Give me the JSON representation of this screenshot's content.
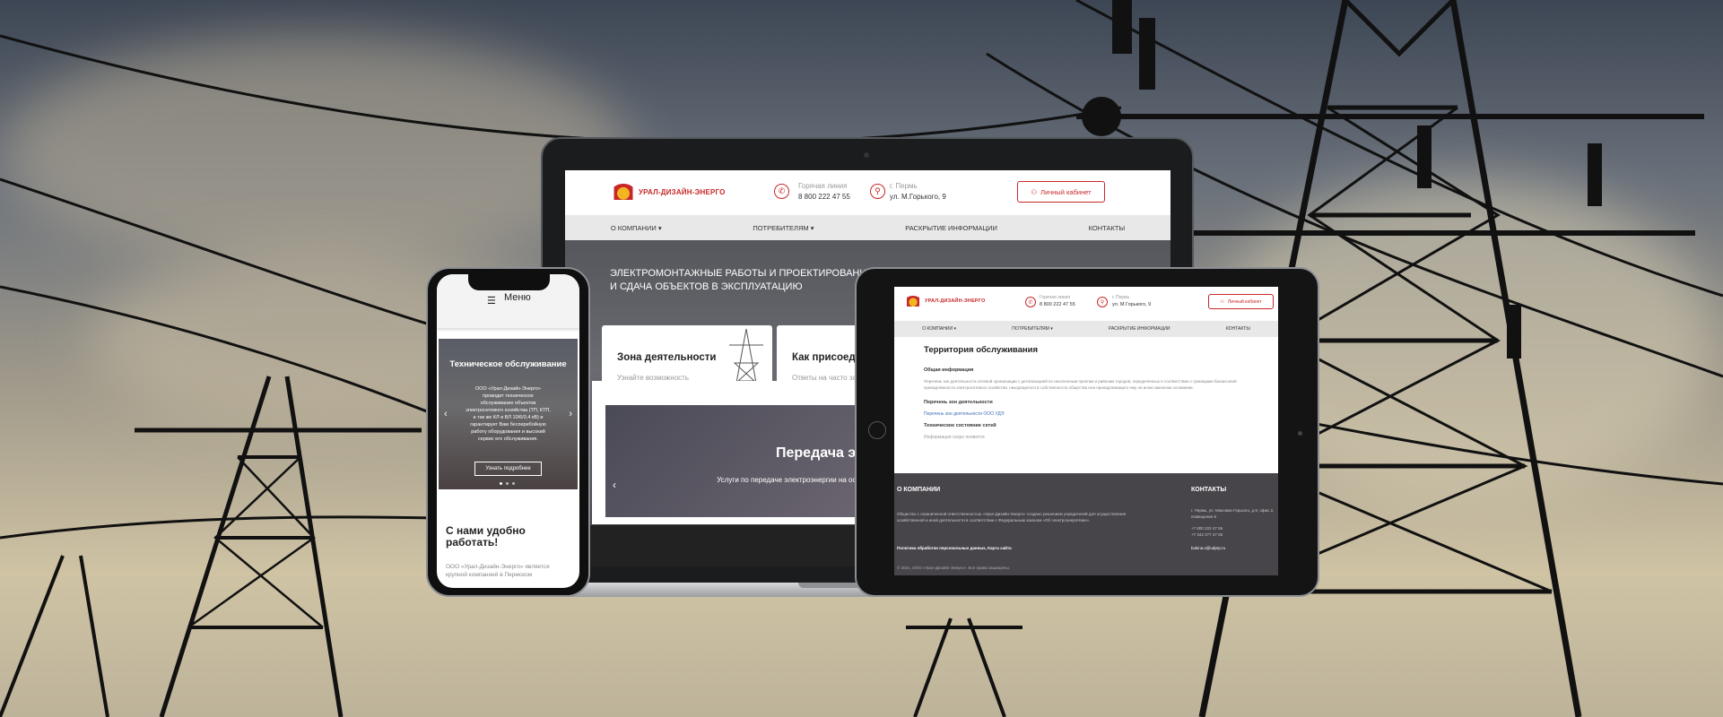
{
  "laptop": {
    "logo_text": "УРАЛ-ДИЗАЙН-ЭНЕРГО",
    "hotline_label": "Горячая линия",
    "hotline_number": "8 800 222 47 55",
    "city": "г. Пермь",
    "address": "ул. М.Горького, 9",
    "cabinet_label": "Личный кабинет",
    "nav": [
      "О КОМПАНИИ",
      "ПОТРЕБИТЕЛЯМ",
      "РАСКРЫТИЕ ИНФОРМАЦИИ",
      "КОНТАКТЫ"
    ],
    "hero_title": "ЭЛЕКТРОМОНТАЖНЫЕ РАБОТЫ И ПРОЕКТИРОВАНИЕ СОГ И СДАЧА ОБЪЕКТОВ В ЭКСПЛУАТАЦИЮ",
    "cards": [
      {
        "title": "Зона деятельности",
        "desc": "Узнайте возможность подключения вашего объекта"
      },
      {
        "title": "Как присоеди",
        "desc": "Ответы на часто зад по присоединению"
      }
    ],
    "slide_title": "Передача э",
    "slide_desc": "Услуги по передаче электроэнергии на осно на период дейст"
  },
  "phone": {
    "menu_label": "Меню",
    "slide_title": "Техническое обслуживание",
    "slide_desc": "ООО «Урал-Дизайн-Энерго» проводит техническое обслуживание объектов электросетевого хозяйства (ТП, КТП, а так же КЛ и ВЛ 10/6/0,4 кВ) и гарантирует Вам бесперебойную работу оборудования и высокий сервис его обслуживания.",
    "slide_button": "Узнать подробнее",
    "section_title": "С нами удобно работать!",
    "section_text": "ООО «Урал-Дизайн-Энерго» является крупной компанией в Пермском"
  },
  "tablet": {
    "logo_text": "УРАЛ-ДИЗАЙН-ЭНЕРГО",
    "hotline_label": "Горячая линия",
    "hotline_number": "8 800 222 47 55",
    "city": "г. Пермь",
    "address": "ул. М.Горького, 9",
    "cabinet_label": "Личный кабинет",
    "nav": [
      "О КОМПАНИИ",
      "ПОТРЕБИТЕЛЯМ",
      "РАСКРЫТИЕ ИНФОРМАЦИИ",
      "КОНТАКТЫ"
    ],
    "page_title": "Территория обслуживания",
    "general_heading": "Общая информация",
    "general_text": "Перечень зон деятельности сетевой организации с детализацией по населенным пунктам и районам городов, определенных в соответствии с границами балансовой принадлежности электросетевого хозяйства, находящегося в собственности общества или принадлежащего ему на ином законном основании.",
    "zones_heading": "Перечень зон деятельности",
    "zones_link": "Перечень зон деятельности ООО УДЭ",
    "tech_heading": "Техническое состояние сетей",
    "tech_text": "Информация скоро появится",
    "footer_company_heading": "О КОМПАНИИ",
    "footer_company_text": "Общество с ограниченной ответственностью «Урал-Дизайн-Энерго» создано решением учредителей для осуществления хозяйственной и иной деятельности в соответствии с Федеральным законом «Об электроэнергетике».",
    "footer_links": "Политика обработки персональных данных, Карта сайта",
    "footer_copyright": "© 2021, ООО «Урал-Дизайн-Энерго». Все права защищены.",
    "footer_contacts_heading": "КОНТАКТЫ",
    "footer_address": "г. Пермь, ул. Максима Горького, д.9, офис 2, помещение 5",
    "footer_phone1": "+7 800 222 47 55",
    "footer_phone2": "+7 342 277 47 05",
    "footer_email": "bukinа.s@udprp.ru"
  },
  "colors": {
    "accent": "#c62828",
    "nav_bg": "#e8e8e8",
    "footer_bg": "#47454a"
  }
}
